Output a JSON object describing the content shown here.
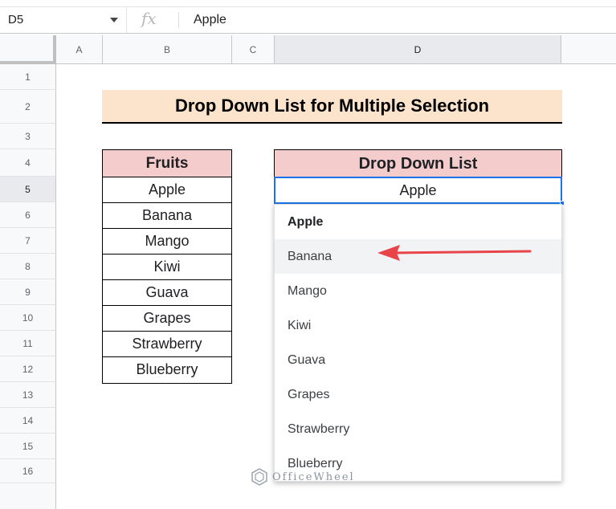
{
  "formula_bar": {
    "cell_ref": "D5",
    "fx_symbol": "fx",
    "value": "Apple"
  },
  "columns": [
    {
      "label": "A"
    },
    {
      "label": "B"
    },
    {
      "label": "C"
    },
    {
      "label": "D"
    },
    {
      "label": ""
    }
  ],
  "rows": [
    "1",
    "2",
    "3",
    "4",
    "5",
    "6",
    "7",
    "8",
    "9",
    "10",
    "11",
    "12",
    "13",
    "14",
    "15",
    "16"
  ],
  "title": "Drop Down List for Multiple Selection",
  "fruits_table": {
    "header": "Fruits",
    "items": [
      "Apple",
      "Banana",
      "Mango",
      "Kiwi",
      "Guava",
      "Grapes",
      "Strawberry",
      "Blueberry"
    ]
  },
  "dropdown": {
    "header": "Drop Down List",
    "selected_value": "Apple",
    "options": [
      "Apple",
      "Banana",
      "Mango",
      "Kiwi",
      "Guava",
      "Grapes",
      "Strawberry",
      "Blueberry"
    ],
    "highlighted_option": "Banana"
  },
  "colors": {
    "title_fill": "#fce4cc",
    "header_fill": "#f4cccc",
    "selection_border": "#1a73e8",
    "arrow": "#e8444a"
  },
  "watermark": {
    "text": "OfficeWheel",
    "icon": "officewheel-logo-icon"
  }
}
